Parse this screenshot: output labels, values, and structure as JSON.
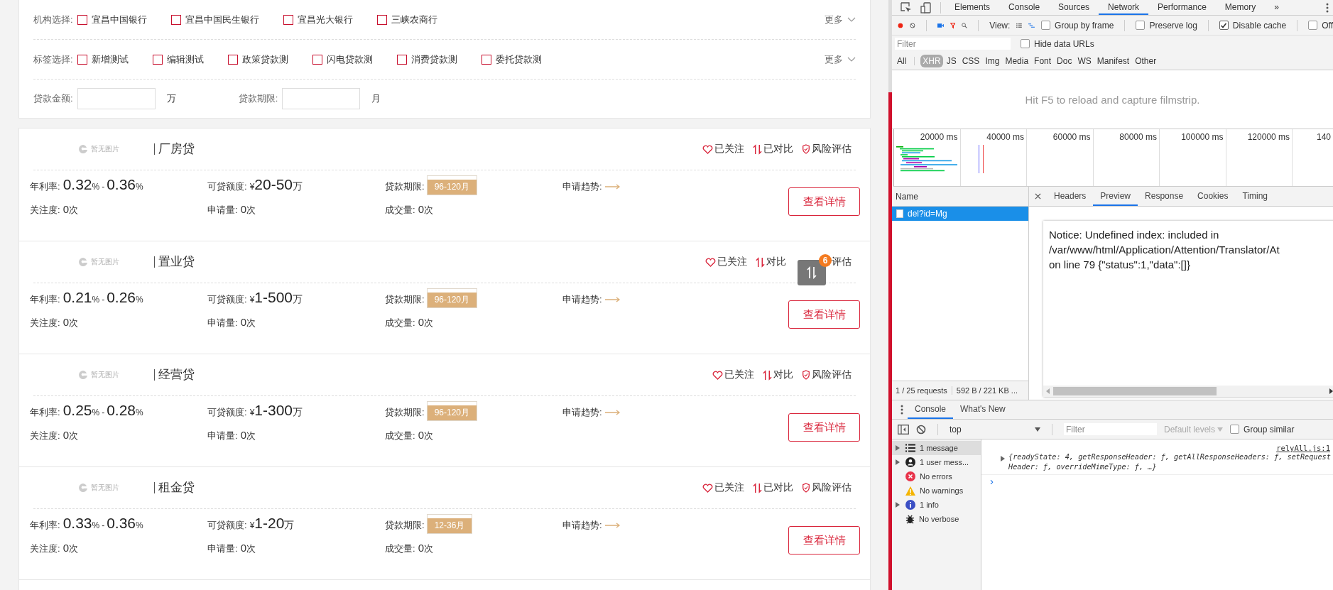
{
  "filters": {
    "institution": {
      "label": "机构选择:",
      "more": "更多",
      "options": [
        {
          "label": "宜昌中国银行",
          "checked": false
        },
        {
          "label": "宜昌中国民生银行",
          "checked": false
        },
        {
          "label": "宜昌光大银行",
          "checked": false
        },
        {
          "label": "三峡农商行",
          "checked": false
        }
      ]
    },
    "tags": {
      "label": "标签选择:",
      "more": "更多",
      "options": [
        {
          "label": "新增测试",
          "checked": false
        },
        {
          "label": "编辑测试",
          "checked": false
        },
        {
          "label": "政策贷款测",
          "checked": false
        },
        {
          "label": "闪电贷款测",
          "checked": false
        },
        {
          "label": "消费贷款测",
          "checked": false
        },
        {
          "label": "委托贷款测",
          "checked": false
        }
      ]
    },
    "amount": {
      "label": "贷款金额:",
      "unit": "万"
    },
    "term": {
      "label": "贷款期限:",
      "unit": "月"
    }
  },
  "products": [
    {
      "logo": "暂无图片",
      "title": "厂房贷",
      "actions": [
        {
          "kind": "follow",
          "label": "已关注",
          "icon": true
        },
        {
          "kind": "compare",
          "label": "已对比",
          "icon": true
        },
        {
          "kind": "risk",
          "label": "风险评估",
          "icon": true
        }
      ],
      "rate_label": "年利率:",
      "rate_low": "0.32",
      "rate_low_unit": "%",
      "rate_sep": "-",
      "rate_high": "0.36",
      "rate_high_unit": "%",
      "amount_label": "可贷额度:",
      "currency": "¥",
      "amount": "20-50",
      "amount_unit": "万",
      "term_label": "贷款期限:",
      "term": "96-120月",
      "trend_label": "申请趋势:",
      "stats": [
        {
          "label": "关注度:",
          "value": "0",
          "unit": "次"
        },
        {
          "label": "申请量:",
          "value": "0",
          "unit": "次"
        },
        {
          "label": "成交量:",
          "value": "0",
          "unit": "次"
        }
      ],
      "button": "查看详情"
    },
    {
      "logo": "暂无图片",
      "title": "置业贷",
      "actions": [
        {
          "kind": "follow",
          "label": "已关注",
          "icon": true
        },
        {
          "kind": "compare",
          "label": "对比",
          "icon": true
        },
        {
          "kind": "risk",
          "label": "评估",
          "icon": false
        }
      ],
      "rate_label": "年利率:",
      "rate_low": "0.21",
      "rate_low_unit": "%",
      "rate_sep": "-",
      "rate_high": "0.26",
      "rate_high_unit": "%",
      "amount_label": "可贷额度:",
      "currency": "¥",
      "amount": "1-500",
      "amount_unit": "万",
      "term_label": "贷款期限:",
      "term": "96-120月",
      "trend_label": "申请趋势:",
      "stats": [
        {
          "label": "关注度:",
          "value": "0",
          "unit": "次"
        },
        {
          "label": "申请量:",
          "value": "0",
          "unit": "次"
        },
        {
          "label": "成交量:",
          "value": "0",
          "unit": "次"
        }
      ],
      "button": "查看详情"
    },
    {
      "logo": "暂无图片",
      "title": "经营贷",
      "actions": [
        {
          "kind": "follow",
          "label": "已关注",
          "icon": true
        },
        {
          "kind": "compare",
          "label": "对比",
          "icon": true
        },
        {
          "kind": "risk",
          "label": "风险评估",
          "icon": true
        }
      ],
      "rate_label": "年利率:",
      "rate_low": "0.25",
      "rate_low_unit": "%",
      "rate_sep": "-",
      "rate_high": "0.28",
      "rate_high_unit": "%",
      "amount_label": "可贷额度:",
      "currency": "¥",
      "amount": "1-300",
      "amount_unit": "万",
      "term_label": "贷款期限:",
      "term": "96-120月",
      "trend_label": "申请趋势:",
      "stats": [
        {
          "label": "关注度:",
          "value": "0",
          "unit": "次"
        },
        {
          "label": "申请量:",
          "value": "0",
          "unit": "次"
        },
        {
          "label": "成交量:",
          "value": "0",
          "unit": "次"
        }
      ],
      "button": "查看详情"
    },
    {
      "logo": "暂无图片",
      "title": "租金贷",
      "actions": [
        {
          "kind": "follow",
          "label": "已关注",
          "icon": true
        },
        {
          "kind": "compare",
          "label": "已对比",
          "icon": true
        },
        {
          "kind": "risk",
          "label": "风险评估",
          "icon": true
        }
      ],
      "rate_label": "年利率:",
      "rate_low": "0.33",
      "rate_low_unit": "%",
      "rate_sep": "-",
      "rate_high": "0.36",
      "rate_high_unit": "%",
      "amount_label": "可贷额度:",
      "currency": "¥",
      "amount": "1-20",
      "amount_unit": "万",
      "term_label": "贷款期限:",
      "term": "12-36月",
      "trend_label": "申请趋势:",
      "stats": [
        {
          "label": "关注度:",
          "value": "0",
          "unit": "次"
        },
        {
          "label": "申请量:",
          "value": "0",
          "unit": "次"
        },
        {
          "label": "成交量:",
          "value": "0",
          "unit": "次"
        }
      ],
      "button": "查看详情"
    }
  ],
  "compare_float": {
    "count": "6"
  },
  "devtools": {
    "tabs": [
      {
        "label": "Elements",
        "selected": false
      },
      {
        "label": "Console",
        "selected": false
      },
      {
        "label": "Sources",
        "selected": false
      },
      {
        "label": "Network",
        "selected": true
      },
      {
        "label": "Performance",
        "selected": false
      },
      {
        "label": "Memory",
        "selected": false
      }
    ],
    "more_tabs": "»",
    "toolbar": {
      "view_label": "View:",
      "checks": [
        {
          "label": "Group by frame",
          "checked": false
        },
        {
          "label": "Preserve log",
          "checked": false
        },
        {
          "label": "Disable cache",
          "checked": true
        },
        {
          "label": "Off",
          "checked": false
        }
      ]
    },
    "filter": {
      "placeholder": "Filter",
      "hide_data_urls": {
        "label": "Hide data URLs",
        "checked": false
      }
    },
    "types": [
      {
        "label": "All",
        "selected": false
      },
      {
        "label": "XHR",
        "selected": true
      },
      {
        "label": "JS",
        "selected": false
      },
      {
        "label": "CSS",
        "selected": false
      },
      {
        "label": "Img",
        "selected": false
      },
      {
        "label": "Media",
        "selected": false
      },
      {
        "label": "Font",
        "selected": false
      },
      {
        "label": "Doc",
        "selected": false
      },
      {
        "label": "WS",
        "selected": false
      },
      {
        "label": "Manifest",
        "selected": false
      },
      {
        "label": "Other",
        "selected": false
      }
    ],
    "filmstrip_hint": "Hit F5 to reload and capture filmstrip.",
    "overview_ticks": [
      "20000 ms",
      "40000 ms",
      "60000 ms",
      "80000 ms",
      "100000 ms",
      "120000 ms",
      "140"
    ],
    "name_header": "Name",
    "requests": [
      {
        "name": "del?id=Mg",
        "selected": true
      }
    ],
    "detail_tabs": [
      {
        "label": "Headers",
        "selected": false
      },
      {
        "label": "Preview",
        "selected": true
      },
      {
        "label": "Response",
        "selected": false
      },
      {
        "label": "Cookies",
        "selected": false
      },
      {
        "label": "Timing",
        "selected": false
      }
    ],
    "preview_lines": [
      "Notice: Undefined index: included in",
      "/var/www/html/Application/Attention/Translator/At",
      "on line 79 {\"status\":1,\"data\":[]}"
    ],
    "summary": [
      "1 / 25 requests",
      "592 B / 221 KB ..."
    ],
    "drawer_tabs": [
      {
        "label": "Console",
        "selected": true
      },
      {
        "label": "What's New",
        "selected": false
      }
    ],
    "console_toolbar": {
      "context": "top",
      "filter_placeholder": "Filter",
      "levels": "Default levels",
      "group_similar": {
        "label": "Group similar",
        "checked": false
      }
    },
    "console_sidebar": [
      {
        "kind": "messages",
        "label": "1 message",
        "expandable": true,
        "selected": true
      },
      {
        "kind": "user",
        "label": "1 user mess...",
        "expandable": true,
        "selected": false
      },
      {
        "kind": "errors",
        "label": "No errors",
        "expandable": false,
        "selected": false
      },
      {
        "kind": "warnings",
        "label": "No warnings",
        "expandable": false,
        "selected": false
      },
      {
        "kind": "info",
        "label": "1 info",
        "expandable": true,
        "selected": false
      },
      {
        "kind": "verbose",
        "label": "No verbose",
        "expandable": false,
        "selected": false
      }
    ],
    "console_messages": [
      {
        "source": "relyAll.js:1",
        "text": "{readyState: 4, getResponseHeader: ƒ, getAllResponseHeaders: ƒ, setRequestHeader: ƒ, overrideMimeType: ƒ, …}"
      }
    ],
    "prompt": "›"
  }
}
